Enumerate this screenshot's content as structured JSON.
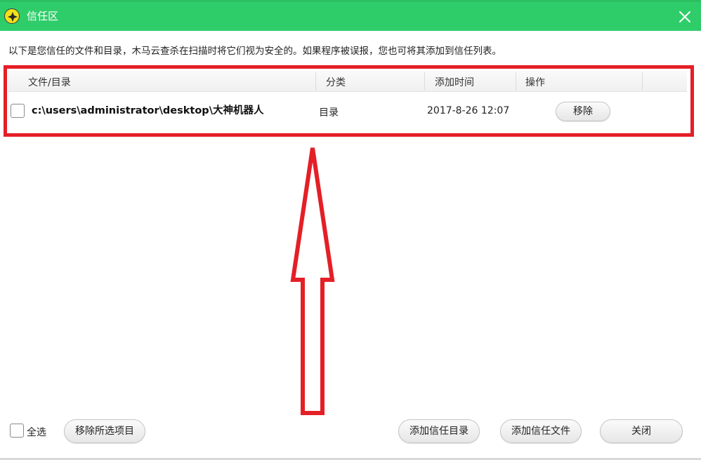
{
  "window": {
    "title": "信任区",
    "accent_color": "#2fcd6a",
    "icons": {
      "app": "app-logo-icon",
      "close": "close-icon"
    }
  },
  "description": "以下是您信任的文件和目录，木马云查杀在扫描时将它们视为安全的。如果程序被误报，您也可将其添加到信任列表。",
  "table": {
    "columns": [
      "文件/目录",
      "分类",
      "添加时间",
      "操作"
    ],
    "rows": [
      {
        "path": "c:\\users\\administrator\\desktop\\大神机器人",
        "type": "目录",
        "time": "2017-8-26 12:07",
        "action": "移除"
      }
    ]
  },
  "annotation": {
    "highlight_color": "#e41f26"
  },
  "footer": {
    "select_all": "全选",
    "remove_selected": "移除所选项目",
    "add_trusted_dir": "添加信任目录",
    "add_trusted_file": "添加信任文件",
    "close": "关闭"
  }
}
